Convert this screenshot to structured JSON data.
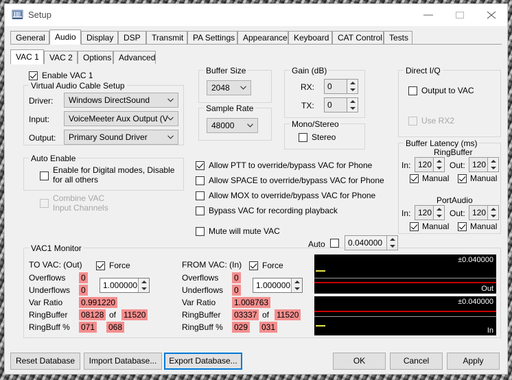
{
  "window": {
    "title": "Setup",
    "icon": "app-icon",
    "minimize": "minimize-icon",
    "maximize": "maximize-icon",
    "close": "close-icon"
  },
  "tabs": {
    "main": [
      {
        "label": "General",
        "selected": false
      },
      {
        "label": "Audio",
        "selected": true
      },
      {
        "label": "Display",
        "selected": false
      },
      {
        "label": "DSP",
        "selected": false
      },
      {
        "label": "Transmit",
        "selected": false
      },
      {
        "label": "PA Settings",
        "selected": false
      },
      {
        "label": "Appearance",
        "selected": false
      },
      {
        "label": "Keyboard",
        "selected": false
      },
      {
        "label": "CAT Control",
        "selected": false
      },
      {
        "label": "Tests",
        "selected": false
      }
    ],
    "sub": [
      {
        "label": "VAC 1",
        "selected": true
      },
      {
        "label": "VAC 2",
        "selected": false
      },
      {
        "label": "Options",
        "selected": false
      },
      {
        "label": "Advanced",
        "selected": false
      }
    ]
  },
  "enable_vac": {
    "label": "Enable VAC 1",
    "checked": true
  },
  "vac_cable": {
    "legend": "Virtual Audio Cable Setup",
    "driver_label": "Driver:",
    "driver_value": "Windows DirectSound",
    "input_label": "Input:",
    "input_value": "VoiceMeeter Aux Output (VB",
    "output_label": "Output:",
    "output_value": "Primary Sound Driver"
  },
  "auto_enable": {
    "legend": "Auto Enable",
    "checkbox_label_line1": "Enable for Digital modes, Disable",
    "checkbox_label_line2": "for all others",
    "checked": false
  },
  "combine_vac": {
    "label_line1": "Combine VAC",
    "label_line2": "Input Channels",
    "checked": false,
    "enabled": false
  },
  "buffer_size": {
    "legend": "Buffer Size",
    "value": "2048"
  },
  "sample_rate": {
    "legend": "Sample Rate",
    "value": "48000"
  },
  "gain": {
    "legend": "Gain (dB)",
    "rx_label": "RX:",
    "rx_value": "0",
    "tx_label": "TX:",
    "tx_value": "0"
  },
  "mono_stereo": {
    "legend": "Mono/Stereo",
    "stereo_label": "Stereo",
    "stereo_checked": false
  },
  "override_options": [
    {
      "label": "Allow PTT to override/bypass VAC for Phone",
      "checked": true
    },
    {
      "label": "Allow SPACE to override/bypass VAC for Phone",
      "checked": false
    },
    {
      "label": "Allow MOX to override/bypass VAC for Phone",
      "checked": false
    },
    {
      "label": "Bypass VAC for recording playback",
      "checked": false
    }
  ],
  "mute_option": {
    "label": "Mute will mute VAC",
    "checked": false
  },
  "auto_scale": {
    "label": "Auto",
    "checked": false,
    "value": "0.040000"
  },
  "direct_iq": {
    "legend": "Direct I/Q",
    "output_to_vac_label": "Output to VAC",
    "output_to_vac_checked": false,
    "use_rx2_label": "Use RX2",
    "use_rx2_checked": false,
    "use_rx2_enabled": false
  },
  "buffer_latency": {
    "legend": "Buffer Latency (ms)",
    "ringbuffer": {
      "title": "RingBuffer",
      "in_label": "In:",
      "in_value": "120",
      "in_manual_label": "Manual",
      "in_manual_checked": true,
      "out_label": "Out:",
      "out_value": "120",
      "out_manual_label": "Manual",
      "out_manual_checked": true
    },
    "portaudio": {
      "title": "PortAudio",
      "in_label": "In:",
      "in_value": "120",
      "in_manual_label": "Manual",
      "in_manual_checked": true,
      "out_label": "Out:",
      "out_value": "120",
      "out_manual_label": "Manual",
      "out_manual_checked": true
    }
  },
  "monitor": {
    "legend": "VAC1 Monitor",
    "rows": [
      "Overflows",
      "Underflows",
      "Var Ratio",
      "RingBuffer",
      "RingBuff %"
    ],
    "of_label": "of",
    "to_vac": {
      "title": "TO VAC: (Out)",
      "force_label": "Force",
      "force_checked": true,
      "ratio_value": "1.000000",
      "overflows": "0",
      "underflows": "0",
      "var_ratio": "0.991220",
      "ringbuffer": "08128",
      "ringbuffer_max": "11520",
      "ringbuff_pct_a": "071",
      "ringbuff_pct_b": "068"
    },
    "from_vac": {
      "title": "FROM VAC: (In)",
      "force_label": "Force",
      "force_checked": true,
      "ratio_value": "1.000000",
      "overflows": "0",
      "underflows": "0",
      "var_ratio": "1.008763",
      "ringbuffer": "03337",
      "ringbuffer_max": "11520",
      "ringbuff_pct_a": "029",
      "ringbuff_pct_b": "031"
    },
    "scope_out": {
      "level": "±0.040000",
      "name": "Out"
    },
    "scope_in": {
      "level": "±0.040000",
      "name": "In"
    }
  },
  "footer": {
    "reset_database": "Reset Database",
    "import_database": "Import Database...",
    "export_database": "Export Database...",
    "ok": "OK",
    "cancel": "Cancel",
    "apply": "Apply"
  },
  "colors": {
    "accent": "#0078d7",
    "alert": "#f48e8e",
    "scope_bg": "#000000",
    "scope_red": "#cc0000",
    "scope_gray": "#9a9a9a",
    "scope_tick": "#e8e84a"
  }
}
